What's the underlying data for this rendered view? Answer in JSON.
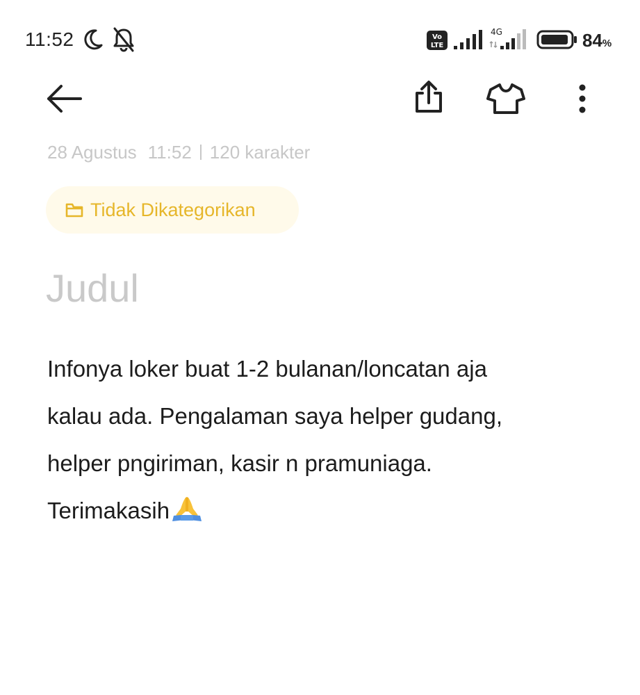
{
  "status_bar": {
    "time": "11:52",
    "network_type": "4G",
    "volte_top": "Vo",
    "volte_bottom": "LTE",
    "battery_percent": "84",
    "battery_unit": "%",
    "icons": [
      "moon-icon",
      "bell-off-icon",
      "volte-icon",
      "signal-bars-icon",
      "4g-signal-icon",
      "battery-icon"
    ]
  },
  "toolbar": {
    "icons": [
      "back-arrow-icon",
      "share-icon",
      "theme-shirt-icon",
      "more-vertical-icon"
    ]
  },
  "note": {
    "date": "28 Agustus",
    "time": "11:52",
    "char_count": "120 karakter",
    "category": "Tidak Dikategorikan",
    "title_placeholder": "Judul",
    "body_lines": [
      "Infonya loker buat 1-2 bulanan/loncatan aja",
      "kalau ada. Pengalaman saya helper gudang,",
      "helper pngiriman, kasir n pramuniaga.",
      "Terimakasih"
    ],
    "body_end_emoji": "folded-hands-emoji"
  },
  "colors": {
    "category_text": "#e6b62a",
    "category_bg": "#fffaea",
    "placeholder": "#c9c9c9",
    "meta": "#c7c7c7",
    "body_text": "#1c1c1c"
  }
}
